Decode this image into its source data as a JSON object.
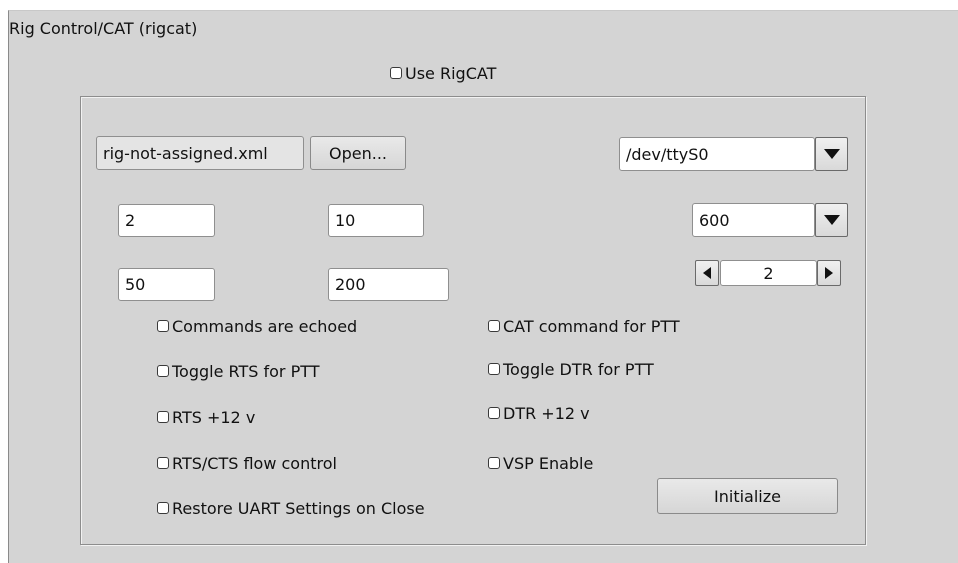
{
  "group": {
    "title": "Rig Control/CAT (rigcat)"
  },
  "use_rigcat": {
    "label": "Use RigCAT",
    "checked": false
  },
  "rig_file": {
    "value": "rig-not-assigned.xml",
    "open_label": "Open..."
  },
  "device": {
    "value": "/dev/ttyS0",
    "icon": "triangle-down"
  },
  "baud": {
    "value": "600",
    "icon": "triangle-down"
  },
  "stopbits": {
    "value": "2",
    "left_icon": "triangle-left",
    "right_icon": "triangle-right"
  },
  "fields": {
    "retries": "2",
    "retry_interval": "10",
    "write_delay": "50",
    "init_delay": "200"
  },
  "options": {
    "commands_echoed": "Commands are echoed",
    "cat_ptt": "CAT command for PTT",
    "toggle_rts_ptt": "Toggle RTS for PTT",
    "toggle_dtr_ptt": "Toggle DTR for PTT",
    "rts_12v": "RTS +12 v",
    "dtr_12v": "DTR +12 v",
    "rts_cts_flow": "RTS/CTS flow control",
    "vsp_enable": "VSP Enable",
    "restore_uart": "Restore UART Settings on Close"
  },
  "initialize_label": "Initialize"
}
